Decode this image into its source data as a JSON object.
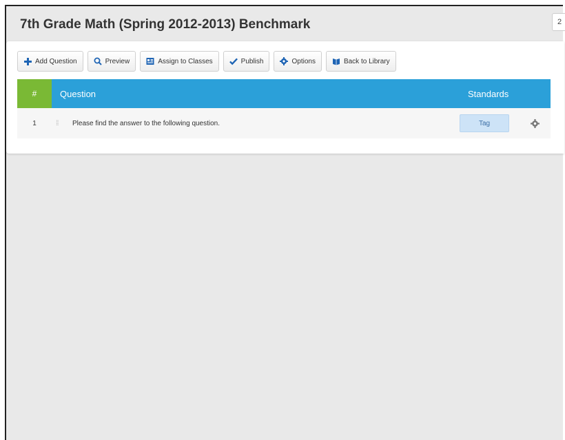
{
  "page": {
    "title": "7th Grade Math (Spring 2012-2013) Benchmark",
    "corner_label": "2"
  },
  "toolbar": {
    "add_question": {
      "label": "Add Question",
      "icon": "plus-icon"
    },
    "preview": {
      "label": "Preview",
      "icon": "search-icon"
    },
    "assign": {
      "label": "Assign to Classes",
      "icon": "classes-icon"
    },
    "publish": {
      "label": "Publish",
      "icon": "check-icon"
    },
    "options": {
      "label": "Options",
      "icon": "gear-icon"
    },
    "back": {
      "label": "Back to Library",
      "icon": "book-icon"
    }
  },
  "table": {
    "headers": {
      "number": "#",
      "question": "Question",
      "standards": "Standards"
    },
    "rows": [
      {
        "number": "1",
        "question": "Please find the answer to the following question.",
        "tag_label": "Tag"
      }
    ]
  },
  "colors": {
    "header_blue": "#2ba0d9",
    "header_green": "#7ab935",
    "tag_bg": "#cde3f7",
    "background": "#e9e9e9"
  }
}
